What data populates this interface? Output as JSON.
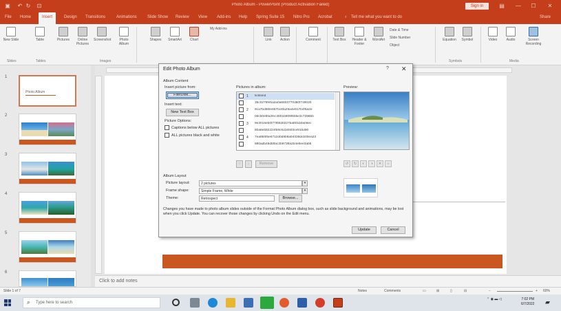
{
  "window": {
    "title": "Photo Album - PowerPoint (Product Activation Failed)",
    "signin_label": "Sign in"
  },
  "menu": {
    "items": [
      "File",
      "Home",
      "Insert",
      "Design",
      "Transitions",
      "Animations",
      "Slide Show",
      "Review",
      "View",
      "Add-ins",
      "Help",
      "Spring Suite 15",
      "Nitro Pro",
      "Acrobat"
    ],
    "active_index": 2,
    "tell_me": "Tell me what you want to do",
    "share_label": "Share"
  },
  "ribbon": {
    "buttons": [
      "New Slide",
      "Table",
      "Pictures",
      "Online Pictures",
      "Screenshot",
      "Photo Album",
      "Shapes",
      "SmartArt",
      "Chart",
      "My Add-ins",
      "Link",
      "Action",
      "Comment",
      "Text Box",
      "Header & Footer",
      "WordArt",
      "Date & Time",
      "Slide Number",
      "Object",
      "Equation",
      "Symbol",
      "Video",
      "Audio",
      "Screen Recording"
    ],
    "groups": [
      "Slides",
      "Tables",
      "Images",
      "Symbols",
      "Media"
    ]
  },
  "slides": {
    "numbers": [
      "1",
      "2",
      "3",
      "4",
      "5",
      "6"
    ],
    "slide1_title": "Photo Album"
  },
  "notes_placeholder": "Click to add notes",
  "status": {
    "slide_info": "Slide 1 of 7",
    "notes_label": "Notes",
    "comments_label": "Comments",
    "zoom": "60%"
  },
  "taskbar": {
    "search_placeholder": "Type here to search",
    "time": "7:02 PM",
    "date": "6/7/2022"
  },
  "dialog": {
    "title": "Edit Photo Album",
    "help": "?",
    "close": "✕",
    "album_content_label": "Album Content",
    "insert_picture_from_label": "Insert picture from:",
    "file_disk_button": "File/Disk...",
    "insert_text_label": "Insert text:",
    "new_text_box_button": "New Text Box",
    "picture_options_label": "Picture Options:",
    "captions_label": "Captions below ALL pictures",
    "bw_label": "ALL pictures black and white",
    "pictures_in_album_label": "Pictures in album:",
    "preview_label": "Preview:",
    "pictures": [
      {
        "num": "1",
        "name": "tickland"
      },
      {
        "num": "",
        "name": "35c0279fe5a2a0a6603770d60f749020"
      },
      {
        "num": "2",
        "name": "9ca7bd56fe657bc6fa29a4e917b4f6a2e"
      },
      {
        "num": "",
        "name": "06cb0e6fa2fec4601b909f6b5e3c7396bb"
      },
      {
        "num": "3",
        "name": "9e3016eb0f7785fd0227ba801b0a06ec"
      },
      {
        "num": "",
        "name": "80a6e592224fb9c6d16503ce910d90"
      },
      {
        "num": "4",
        "name": "7ea9b6f5e6712d0d8b9a94438dcb00ea23"
      },
      {
        "num": "",
        "name": "880adb49d5ffac2b9738a2b4e6ee3ab6"
      }
    ],
    "selected_picture_index": 0,
    "remove_button": "Remove",
    "album_layout_label": "Album Layout",
    "picture_layout_label": "Picture layout:",
    "picture_layout_value": "2 pictures",
    "frame_shape_label": "Frame shape:",
    "frame_shape_value": "Simple Frame, White",
    "theme_label": "Theme:",
    "theme_value": "Retrospect",
    "browse_button": "Browse...",
    "notice": "Changes you have made to photo album slides outside of the Format Photo Album dialog box, such as slide background and animations, may be lost when you click Update. You can recover those changes by clicking Undo on the Edit menu.",
    "update_button": "Update",
    "cancel_button": "Cancel"
  },
  "colors": {
    "accent": "#c43e1c",
    "slide_band": "#c9571f"
  }
}
